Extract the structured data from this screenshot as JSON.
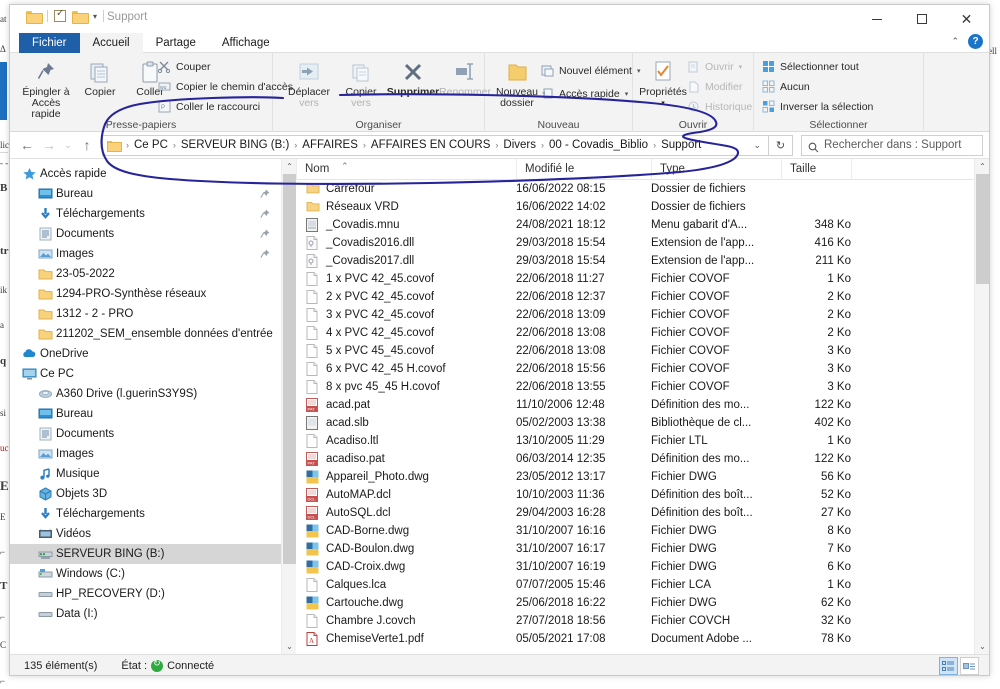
{
  "window": {
    "title": "Support",
    "minimize_label": "Réduire",
    "maximize_label": "Agrandir",
    "close_label": "Fermer"
  },
  "tabs": [
    {
      "label": "Fichier",
      "state": "file"
    },
    {
      "label": "Accueil",
      "state": "active"
    },
    {
      "label": "Partage",
      "state": "normal"
    },
    {
      "label": "Affichage",
      "state": "normal"
    }
  ],
  "ribbon": {
    "groups": [
      {
        "name": "Presse-papiers",
        "label": "Presse-papiers"
      },
      {
        "name": "Organiser",
        "label": "Organiser"
      },
      {
        "name": "Nouveau",
        "label": "Nouveau"
      },
      {
        "name": "Ouvrir",
        "label": "Ouvrir"
      },
      {
        "name": "Selectionner",
        "label": "Sélectionner"
      }
    ],
    "clipboard": {
      "pin_line1": "Épingler à",
      "pin_line2": "Accès rapide",
      "copy": "Copier",
      "paste": "Coller",
      "cut": "Couper",
      "copy_path": "Copier le chemin d'accès",
      "paste_shortcut": "Coller le raccourci"
    },
    "organize": {
      "move_to_line1": "Déplacer",
      "move_to_line2": "vers",
      "copy_to_line1": "Copier",
      "copy_to_line2": "vers",
      "delete": "Supprimer",
      "rename": "Renommer"
    },
    "newgroup": {
      "new_folder_line1": "Nouveau",
      "new_folder_line2": "dossier",
      "new_item": "Nouvel élément",
      "quick_access": "Accès rapide"
    },
    "open": {
      "properties": "Propriétés",
      "open": "Ouvrir",
      "edit": "Modifier",
      "history": "Historique"
    },
    "select": {
      "select_all": "Sélectionner tout",
      "select_none": "Aucun",
      "invert": "Inverser la sélection"
    }
  },
  "address": {
    "crumbs": [
      "Ce PC",
      "SERVEUR BING (B:)",
      "AFFAIRES",
      "AFFAIRES EN COURS",
      "Divers",
      "00 - Covadis_Biblio",
      "Support"
    ],
    "separator": "›",
    "dropdown_icon": "chevron-down-icon",
    "refresh_icon": "refresh-icon",
    "back_icon": "arrow-left-icon",
    "forward_icon": "arrow-right-icon",
    "recent_icon": "chevron-down-icon",
    "up_icon": "arrow-up-icon"
  },
  "search": {
    "placeholder": "Rechercher dans : Support",
    "icon": "search-icon"
  },
  "sidebar": {
    "items": [
      {
        "label": "Accès rapide",
        "icon": "star-icon",
        "indent": 0,
        "pinned": false,
        "selected": false
      },
      {
        "label": "Bureau",
        "icon": "desktop-icon",
        "indent": 1,
        "pinned": true,
        "selected": false
      },
      {
        "label": "Téléchargements",
        "icon": "download-icon",
        "indent": 1,
        "pinned": true,
        "selected": false
      },
      {
        "label": "Documents",
        "icon": "documents-icon",
        "indent": 1,
        "pinned": true,
        "selected": false
      },
      {
        "label": "Images",
        "icon": "pictures-icon",
        "indent": 1,
        "pinned": true,
        "selected": false
      },
      {
        "label": "23-05-2022",
        "icon": "folder-icon",
        "indent": 1,
        "pinned": false,
        "selected": false
      },
      {
        "label": "1294-PRO-Synthèse réseaux",
        "icon": "folder-icon",
        "indent": 1,
        "pinned": false,
        "selected": false
      },
      {
        "label": "1312 - 2 - PRO",
        "icon": "folder-icon",
        "indent": 1,
        "pinned": false,
        "selected": false
      },
      {
        "label": "211202_SEM_ensemble données d'entrée",
        "icon": "folder-icon",
        "indent": 1,
        "pinned": false,
        "selected": false
      },
      {
        "label": "OneDrive",
        "icon": "onedrive-icon",
        "indent": 0,
        "pinned": false,
        "selected": false
      },
      {
        "label": "Ce PC",
        "icon": "thispc-icon",
        "indent": 0,
        "pinned": false,
        "selected": false
      },
      {
        "label": "A360 Drive (l.guerinS3Y9S)",
        "icon": "cloud-drive-icon",
        "indent": 1,
        "pinned": false,
        "selected": false
      },
      {
        "label": "Bureau",
        "icon": "desktop-icon",
        "indent": 1,
        "pinned": false,
        "selected": false
      },
      {
        "label": "Documents",
        "icon": "documents-icon",
        "indent": 1,
        "pinned": false,
        "selected": false
      },
      {
        "label": "Images",
        "icon": "pictures-icon",
        "indent": 1,
        "pinned": false,
        "selected": false
      },
      {
        "label": "Musique",
        "icon": "music-icon",
        "indent": 1,
        "pinned": false,
        "selected": false
      },
      {
        "label": "Objets 3D",
        "icon": "objects3d-icon",
        "indent": 1,
        "pinned": false,
        "selected": false
      },
      {
        "label": "Téléchargements",
        "icon": "download-icon",
        "indent": 1,
        "pinned": false,
        "selected": false
      },
      {
        "label": "Vidéos",
        "icon": "videos-icon",
        "indent": 1,
        "pinned": false,
        "selected": false
      },
      {
        "label": "SERVEUR BING (B:)",
        "icon": "network-drive-icon",
        "indent": 1,
        "pinned": false,
        "selected": true
      },
      {
        "label": "Windows  (C:)",
        "icon": "windows-drive-icon",
        "indent": 1,
        "pinned": false,
        "selected": false
      },
      {
        "label": "HP_RECOVERY (D:)",
        "icon": "drive-icon",
        "indent": 1,
        "pinned": false,
        "selected": false
      },
      {
        "label": "Data (I:)",
        "icon": "drive-icon",
        "indent": 1,
        "pinned": false,
        "selected": false
      }
    ]
  },
  "filelist": {
    "columns": [
      {
        "key": "name",
        "label": "Nom",
        "sorted": true
      },
      {
        "key": "date",
        "label": "Modifié le",
        "sorted": false
      },
      {
        "key": "type",
        "label": "Type",
        "sorted": false
      },
      {
        "key": "size",
        "label": "Taille",
        "sorted": false
      }
    ],
    "rows": [
      {
        "name": "Carrefour",
        "date": "16/06/2022 08:15",
        "type": "Dossier de fichiers",
        "size": "",
        "icon": "folder-icon"
      },
      {
        "name": "Réseaux VRD",
        "date": "16/06/2022 14:02",
        "type": "Dossier de fichiers",
        "size": "",
        "icon": "folder-icon"
      },
      {
        "name": "_Covadis.mnu",
        "date": "24/08/2021 18:12",
        "type": "Menu gabarit d'A...",
        "size": "348 Ko",
        "icon": "menu-file-icon"
      },
      {
        "name": "_Covadis2016.dll",
        "date": "29/03/2018 15:54",
        "type": "Extension de l'app...",
        "size": "416 Ko",
        "icon": "dll-file-icon"
      },
      {
        "name": "_Covadis2017.dll",
        "date": "29/03/2018 15:54",
        "type": "Extension de l'app...",
        "size": "211 Ko",
        "icon": "dll-file-icon"
      },
      {
        "name": "1 x PVC 42_45.covof",
        "date": "22/06/2018 11:27",
        "type": "Fichier COVOF",
        "size": "1 Ko",
        "icon": "blank-file-icon"
      },
      {
        "name": "2 x PVC 42_45.covof",
        "date": "22/06/2018 12:37",
        "type": "Fichier COVOF",
        "size": "2 Ko",
        "icon": "blank-file-icon"
      },
      {
        "name": "3 x PVC 42_45.covof",
        "date": "22/06/2018 13:09",
        "type": "Fichier COVOF",
        "size": "2 Ko",
        "icon": "blank-file-icon"
      },
      {
        "name": "4 x PVC 42_45.covof",
        "date": "22/06/2018 13:08",
        "type": "Fichier COVOF",
        "size": "2 Ko",
        "icon": "blank-file-icon"
      },
      {
        "name": "5 x PVC 45_45.covof",
        "date": "22/06/2018 13:08",
        "type": "Fichier COVOF",
        "size": "3 Ko",
        "icon": "blank-file-icon"
      },
      {
        "name": "6 x PVC 42_45 H.covof",
        "date": "22/06/2018 15:56",
        "type": "Fichier COVOF",
        "size": "3 Ko",
        "icon": "blank-file-icon"
      },
      {
        "name": "8 x pvc 45_45 H.covof",
        "date": "22/06/2018 13:55",
        "type": "Fichier COVOF",
        "size": "3 Ko",
        "icon": "blank-file-icon"
      },
      {
        "name": "acad.pat",
        "date": "11/10/2006 12:48",
        "type": "Définition des mo...",
        "size": "122 Ko",
        "icon": "pat-file-icon"
      },
      {
        "name": "acad.slb",
        "date": "05/02/2003 13:38",
        "type": "Bibliothèque de cl...",
        "size": "402 Ko",
        "icon": "slb-file-icon"
      },
      {
        "name": "Acadiso.ltl",
        "date": "13/10/2005 11:29",
        "type": "Fichier LTL",
        "size": "1 Ko",
        "icon": "blank-file-icon"
      },
      {
        "name": "acadiso.pat",
        "date": "06/03/2014 12:35",
        "type": "Définition des mo...",
        "size": "122 Ko",
        "icon": "pat-file-icon"
      },
      {
        "name": "Appareil_Photo.dwg",
        "date": "23/05/2012 13:17",
        "type": "Fichier DWG",
        "size": "56 Ko",
        "icon": "dwg-file-icon"
      },
      {
        "name": "AutoMAP.dcl",
        "date": "10/10/2003 11:36",
        "type": "Définition des boît...",
        "size": "52 Ko",
        "icon": "dcl-file-icon"
      },
      {
        "name": "AutoSQL.dcl",
        "date": "29/04/2003 16:28",
        "type": "Définition des boît...",
        "size": "27 Ko",
        "icon": "dcl-file-icon"
      },
      {
        "name": "CAD-Borne.dwg",
        "date": "31/10/2007 16:16",
        "type": "Fichier DWG",
        "size": "8 Ko",
        "icon": "dwg-file-icon"
      },
      {
        "name": "CAD-Boulon.dwg",
        "date": "31/10/2007 16:17",
        "type": "Fichier DWG",
        "size": "7 Ko",
        "icon": "dwg-file-icon"
      },
      {
        "name": "CAD-Croix.dwg",
        "date": "31/10/2007 16:19",
        "type": "Fichier DWG",
        "size": "6 Ko",
        "icon": "dwg-file-icon"
      },
      {
        "name": "Calques.lca",
        "date": "07/07/2005 15:46",
        "type": "Fichier LCA",
        "size": "1 Ko",
        "icon": "blank-file-icon"
      },
      {
        "name": "Cartouche.dwg",
        "date": "25/06/2018 16:22",
        "type": "Fichier DWG",
        "size": "62 Ko",
        "icon": "dwg-file-icon"
      },
      {
        "name": "Chambre J.covch",
        "date": "27/07/2018 18:56",
        "type": "Fichier COVCH",
        "size": "32 Ko",
        "icon": "blank-file-icon"
      },
      {
        "name": "ChemiseVerte1.pdf",
        "date": "05/05/2021 17:08",
        "type": "Document Adobe ...",
        "size": "78 Ko",
        "icon": "pdf-file-icon"
      }
    ]
  },
  "statusbar": {
    "item_count": "135 élément(s)",
    "state_label": "État :",
    "state_value": "Connecté",
    "details_view_label": "Affichage Détails",
    "content_view_label": "Affichage Contenu"
  },
  "annotation": {
    "type": "hand-drawn-ellipse",
    "color": "#27249b",
    "target": "address-bar"
  },
  "background_text": {
    "fragments": [
      "at",
      "B",
      "tr",
      "ik",
      "a",
      "q",
      "si",
      "uc",
      "E",
      "E",
      "u",
      "T",
      "C",
      "J",
      "J",
      "cell"
    ]
  }
}
